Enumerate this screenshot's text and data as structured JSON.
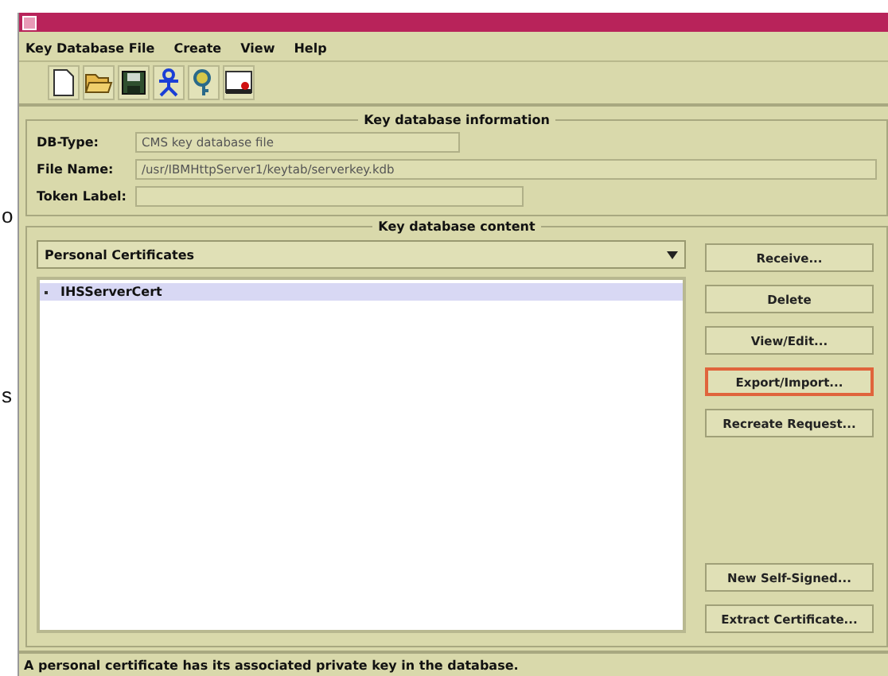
{
  "background_fragments": [
    "o",
    "s"
  ],
  "menu": [
    {
      "label": "Key Database File"
    },
    {
      "label": "Create"
    },
    {
      "label": "View"
    },
    {
      "label": "Help"
    }
  ],
  "toolbar": [
    {
      "kind": "new"
    },
    {
      "kind": "open"
    },
    {
      "kind": "save"
    },
    {
      "kind": "person"
    },
    {
      "kind": "key"
    },
    {
      "kind": "screen"
    }
  ],
  "info": {
    "title": "Key database information",
    "fields": [
      {
        "label": "DB-Type:",
        "value": "CMS key database file"
      },
      {
        "label": "File Name:",
        "value": "/usr/IBMHttpServer1/keytab/serverkey.kdb"
      },
      {
        "label": "Token Label:"
      }
    ]
  },
  "content": {
    "title": "Key database content",
    "dropdown": {
      "value": "Personal Certificates"
    },
    "list": [
      {
        "label": "IHSServerCert",
        "selected": true
      }
    ],
    "buttons": [
      {
        "label": "Receive...",
        "highlighted": false
      },
      {
        "label": "Delete",
        "highlighted": false
      },
      {
        "label": "View/Edit...",
        "highlighted": false
      },
      {
        "label": "Export/Import...",
        "highlighted": true
      },
      {
        "label": "Recreate Request...",
        "highlighted": false
      },
      {
        "label": "New Self-Signed...",
        "highlighted": false
      },
      {
        "label": "Extract Certificate...",
        "highlighted": false
      }
    ]
  },
  "status_bar": "A personal certificate has its associated private key in the database."
}
